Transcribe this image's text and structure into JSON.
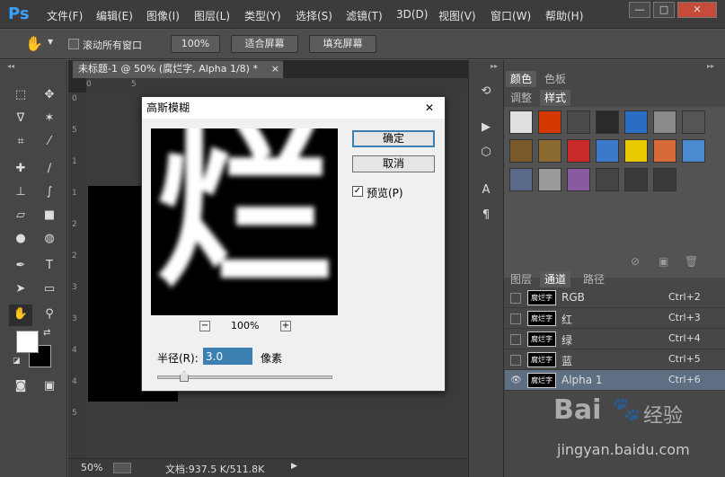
{
  "app": {
    "logo": "Ps",
    "brand_color": "#3aa0ff"
  },
  "menu": [
    "文件(F)",
    "编辑(E)",
    "图像(I)",
    "图层(L)",
    "类型(Y)",
    "选择(S)",
    "滤镜(T)",
    "3D(D)",
    "视图(V)",
    "窗口(W)",
    "帮助(H)"
  ],
  "window_controls": {
    "minimize": "—",
    "restore": "□",
    "close": "✕"
  },
  "options": {
    "scroll_all_label": "滚动所有窗口",
    "zoom_label": "100%",
    "fit_label": "适合屏幕",
    "fill_label": "填充屏幕"
  },
  "document": {
    "tab_title": "未标题-1 @ 50% (腐烂字, Alpha 1/8) *",
    "tab_close": "×",
    "ruler_v": [
      "0",
      "5",
      "1",
      "1",
      "2",
      "2",
      "3",
      "3",
      "4",
      "4",
      "5"
    ],
    "ruler_h": [
      "0",
      "5"
    ]
  },
  "status": {
    "zoom": "50%",
    "info": "文档:937.5 K/511.8K",
    "arrow": "▶"
  },
  "dialog": {
    "title": "高斯模糊",
    "close": "✕",
    "ok": "确定",
    "cancel": "取消",
    "preview_label": "预览(P)",
    "zoom": "100%",
    "zoom_minus": "−",
    "zoom_plus": "+",
    "radius_label": "半径(R):",
    "radius_value": "3.0",
    "unit": "像素",
    "preview_text": "烂"
  },
  "panels": {
    "top_tabs": [
      "颜色",
      "色板"
    ],
    "second_tabs": [
      "调整",
      "样式"
    ],
    "bottom_tabs": [
      "图层",
      "通道",
      "路径"
    ],
    "channels": [
      {
        "name": "RGB",
        "shortcut": "Ctrl+2",
        "thumb": "腐烂字"
      },
      {
        "name": "红",
        "shortcut": "Ctrl+3",
        "thumb": "腐烂字"
      },
      {
        "name": "绿",
        "shortcut": "Ctrl+4",
        "thumb": "腐烂字"
      },
      {
        "name": "蓝",
        "shortcut": "Ctrl+5",
        "thumb": "腐烂字"
      },
      {
        "name": "Alpha 1",
        "shortcut": "Ctrl+6",
        "thumb": "腐烂字"
      }
    ],
    "styles_colors": [
      "#e0e0e0",
      "#d43a00",
      "#4a4a4a",
      "#2a2a2a",
      "#2b6cc4",
      "#8a8a8a",
      "#555555",
      "#7a5a2a",
      "#8a6a30",
      "#c82a2a",
      "#3a7ac8",
      "#e8c800",
      "#d86a3a",
      "#4a8ad0",
      "#5a6a8a",
      "#999999",
      "#8a5aa0",
      "#444444",
      "#3a3a3a",
      "#3a3a3a"
    ]
  },
  "watermark": {
    "brand": "Bai",
    "brand_suffix": "经验",
    "url": "jingyan.baidu.com"
  }
}
